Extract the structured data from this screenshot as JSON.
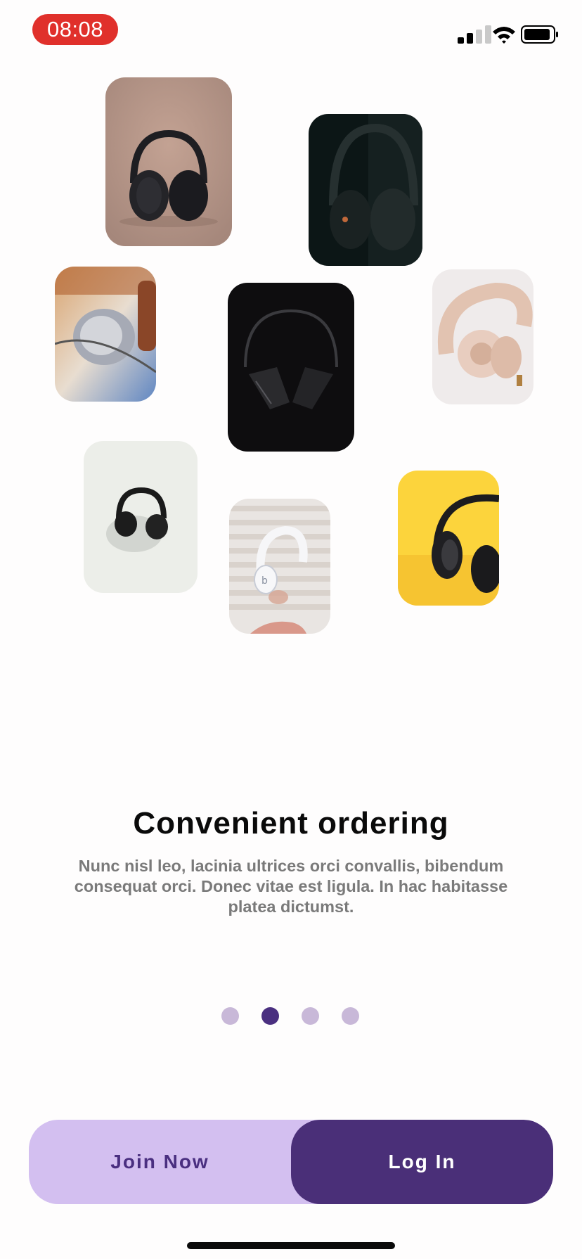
{
  "status_bar": {
    "time": "08:08",
    "signal_icon": "cellular-signal-icon",
    "wifi_icon": "wifi-icon",
    "battery_icon": "battery-icon"
  },
  "gallery": {
    "items": [
      {
        "name": "headphones-photo-1",
        "subject": "black over-ear headphones on tan background",
        "colors": [
          "#b7978b",
          "#1e1e22"
        ]
      },
      {
        "name": "headphones-photo-2",
        "subject": "dark headphones on black background",
        "colors": [
          "#0c1616",
          "#222a2a"
        ]
      },
      {
        "name": "headphones-photo-3",
        "subject": "close-up of metallic earcup",
        "colors": [
          "#b67b4a",
          "#6a86b8"
        ]
      },
      {
        "name": "headphones-photo-4",
        "subject": "black headphones on black background",
        "colors": [
          "#0e0d0f",
          "#2a2a2d"
        ]
      },
      {
        "name": "headphones-photo-5",
        "subject": "beige folded headphones on white",
        "colors": [
          "#eeeaea",
          "#e3c3b0"
        ]
      },
      {
        "name": "headphones-photo-6",
        "subject": "small black headphones on grey",
        "colors": [
          "#eceee9",
          "#1a1a1a"
        ]
      },
      {
        "name": "headphones-photo-7",
        "subject": "white headphones floating over hand",
        "colors": [
          "#ece8e5",
          "#f4f4f6"
        ]
      },
      {
        "name": "headphones-photo-8",
        "subject": "black headphones on yellow background",
        "colors": [
          "#fcd43c",
          "#1c1c1e"
        ]
      }
    ]
  },
  "onboarding": {
    "title": "Convenient ordering",
    "description": "Nunc nisl leo, lacinia ultrices orci convallis, bibendum consequat orci. Donec vitae est ligula. In hac habitasse platea dictumst.",
    "page_count": 4,
    "active_page": 2
  },
  "actions": {
    "join_label": "Join Now",
    "login_label": "Log In"
  },
  "colors": {
    "accent": "#4a2f80",
    "accent_light": "#d3bff0",
    "dot_inactive": "#c8b8d8",
    "time_pill": "#e0302b"
  }
}
